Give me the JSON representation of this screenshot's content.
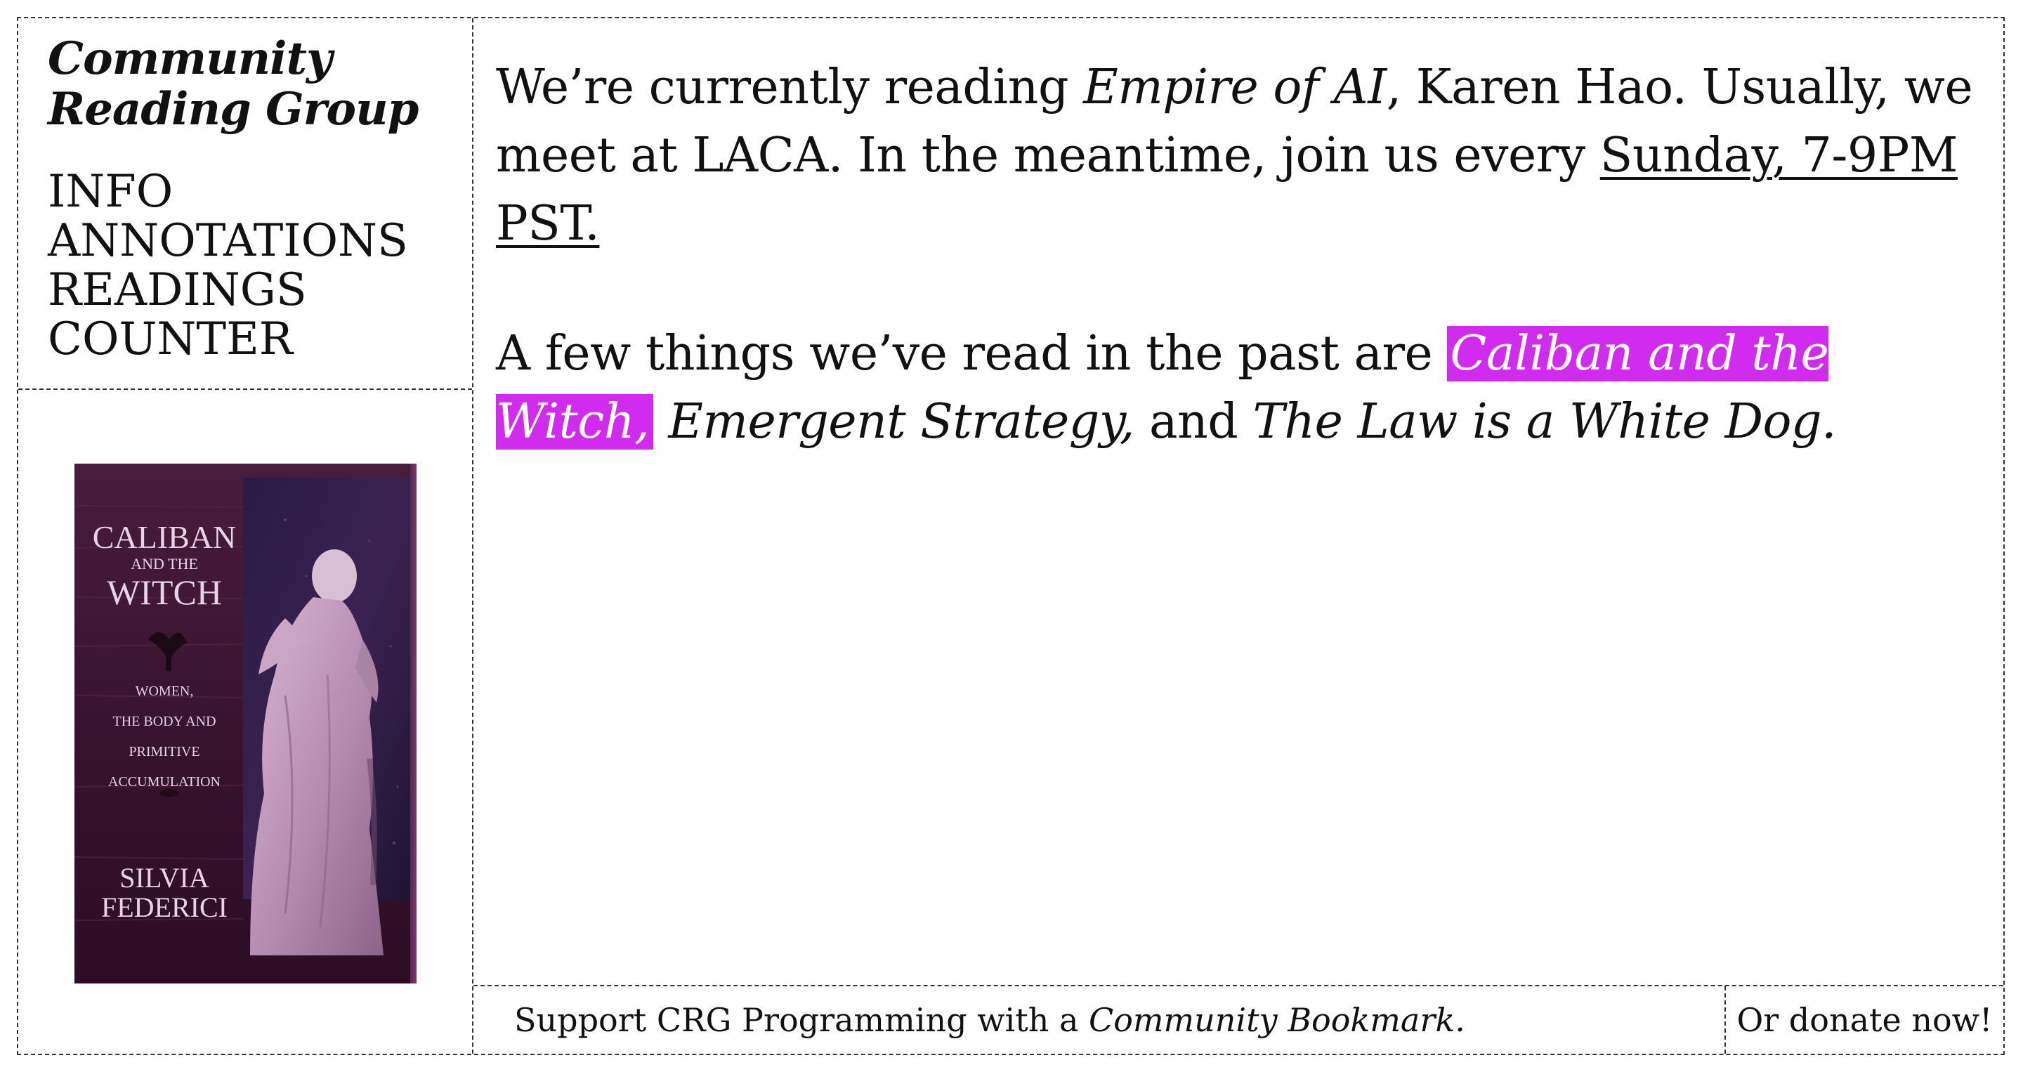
{
  "sidebar": {
    "title_line1": "Community",
    "title_line2": "Reading Group",
    "nav": [
      {
        "label": "INFO"
      },
      {
        "label": "ANNOTATIONS"
      },
      {
        "label": "READINGS"
      },
      {
        "label": "COUNTER"
      }
    ],
    "cover": {
      "title_line1": "CALIBAN",
      "title_line2": "AND THE",
      "title_line3": "WITCH",
      "subtitle_line1": "WOMEN,",
      "subtitle_line2": "THE BODY AND",
      "subtitle_line3": "PRIMITIVE",
      "subtitle_line4": "ACCUMULATION",
      "author_line1": "SILVIA",
      "author_line2": "FEDERICI"
    }
  },
  "main": {
    "intro": {
      "text1": "We’re currently reading ",
      "current_book": "Empire of AI",
      "text2": ", Karen Hao. Usually, we meet at LACA. In the meantime, join us every ",
      "schedule_link": "Sunday, 7-9PM PST."
    },
    "past": {
      "text1": "A few things we’ve read in the past are ",
      "book1": "Caliban and the Witch,",
      "text2": " ",
      "book2": "Emergent Strategy,",
      "text3": " and ",
      "book3": "The Law is a White Dog."
    }
  },
  "footer": {
    "support_text": "Support CRG Programming with a ",
    "bookmark_link": "Community Bookmark.",
    "donate_label": "Or donate now!"
  },
  "colors": {
    "highlight": "#d12bf0",
    "border": "#333333",
    "text": "#111111",
    "cover_background": "#3b1530"
  }
}
